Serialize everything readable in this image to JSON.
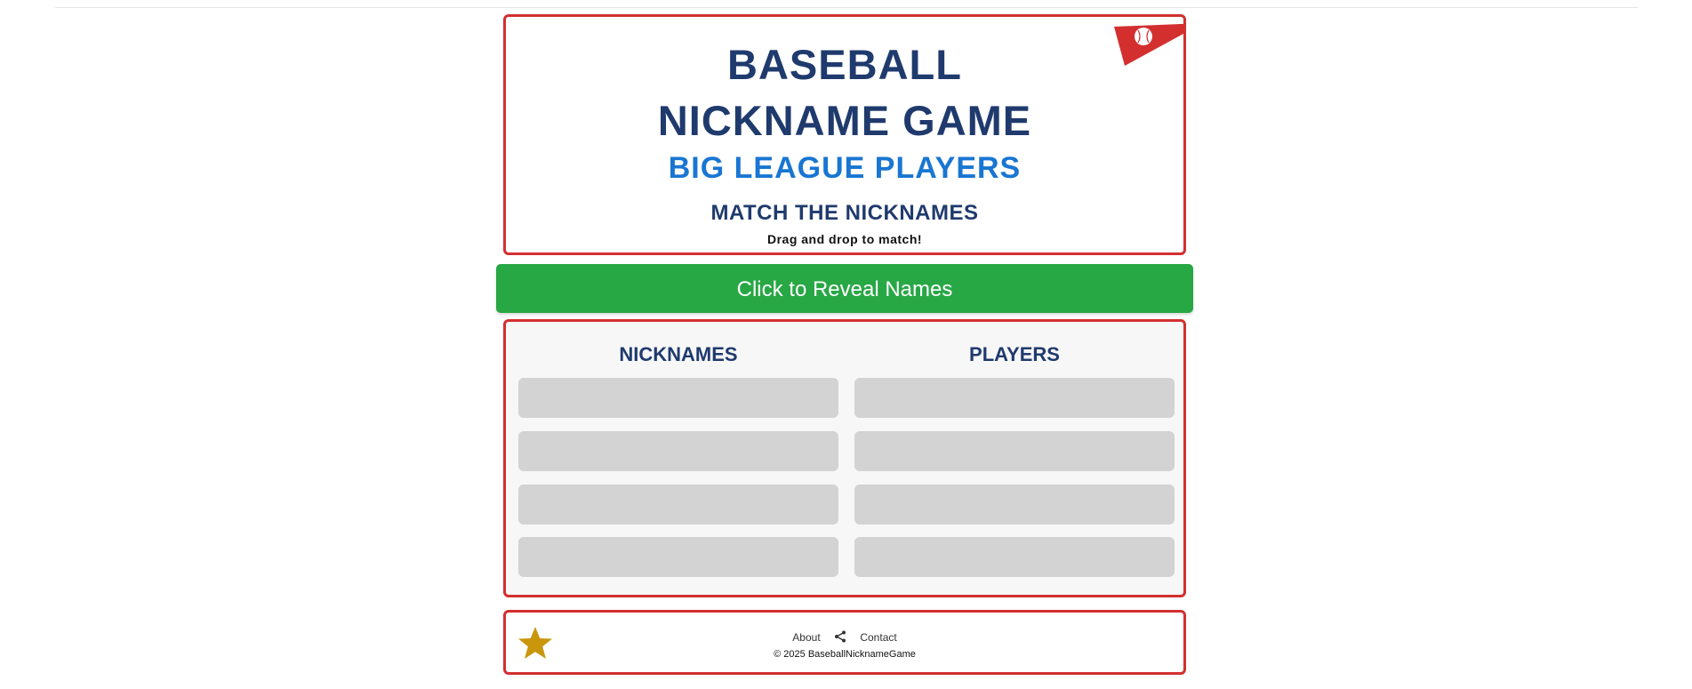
{
  "header": {
    "title_line1": "BASEBALL",
    "title_line2": "NICKNAME GAME",
    "subtitle": "BIG LEAGUE PLAYERS",
    "section_title": "MATCH THE NICKNAMES",
    "instruction": "Drag and drop to match!",
    "pennant_icon": "baseball-pennant-icon",
    "accent_color": "#d32f2f",
    "title_color": "#1f3a6d",
    "subtitle_color": "#1976d2"
  },
  "reveal_button": {
    "label": "Click to Reveal Names",
    "color": "#28a745"
  },
  "game": {
    "nicknames_heading": "NICKNAMES",
    "players_heading": "PLAYERS",
    "nickname_slots": [
      "",
      "",
      "",
      ""
    ],
    "player_slots": [
      "",
      "",
      "",
      ""
    ],
    "slot_color": "#d3d3d3"
  },
  "footer": {
    "star_icon": "star-icon",
    "about_label": "About",
    "share_icon": "share-icon",
    "contact_label": "Contact",
    "copyright": "© 2025 BaseballNicknameGame",
    "star_color": "#c9960c"
  }
}
